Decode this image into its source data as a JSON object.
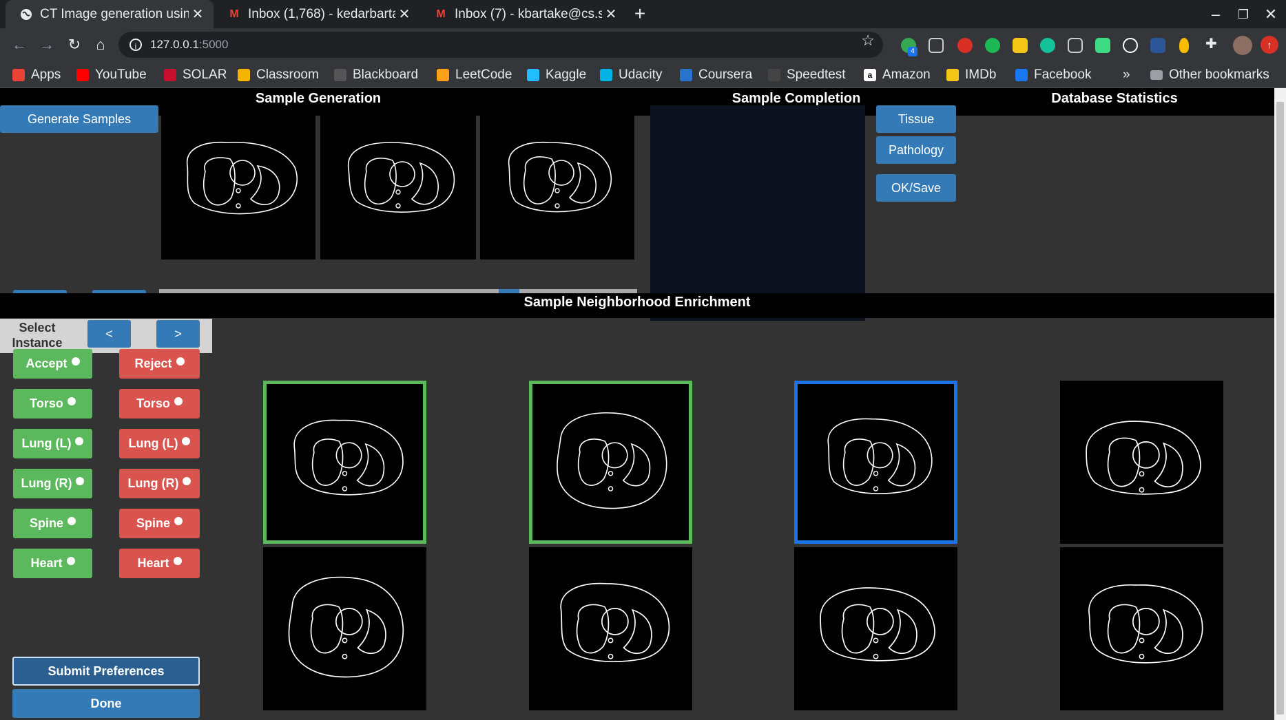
{
  "browser": {
    "tabs": [
      {
        "title": "CT Image generation usin",
        "icon": "globe-icon",
        "active": true
      },
      {
        "title": "Inbox (1,768) - kedarbarta",
        "icon": "gmail-icon",
        "active": false
      },
      {
        "title": "Inbox (7) - kbartake@cs.st",
        "icon": "gmail-icon",
        "active": false
      }
    ],
    "url_host": "127.0.0.1",
    "url_port": ":5000",
    "bookmarks": [
      {
        "label": "Apps",
        "icon": "apps-grid-icon",
        "color": "#ea4335"
      },
      {
        "label": "YouTube",
        "icon": "youtube-icon",
        "color": "#ff0000"
      },
      {
        "label": "SOLAR",
        "icon": "solar-shield-icon",
        "color": "#c8102e"
      },
      {
        "label": "Classroom",
        "icon": "classroom-icon",
        "color": "#f4b400"
      },
      {
        "label": "Blackboard",
        "icon": "blackboard-icon",
        "color": "#555555"
      },
      {
        "label": "LeetCode",
        "icon": "leetcode-icon",
        "color": "#ffa116"
      },
      {
        "label": "Kaggle",
        "icon": "kaggle-icon",
        "color": "#20beff"
      },
      {
        "label": "Udacity",
        "icon": "udacity-icon",
        "color": "#02b3e4"
      },
      {
        "label": "Coursera",
        "icon": "coursera-icon",
        "color": "#2a73cc"
      },
      {
        "label": "Speedtest",
        "icon": "speedtest-icon",
        "color": "#444444"
      },
      {
        "label": "Amazon",
        "icon": "amazon-icon",
        "color": "#ffffff"
      },
      {
        "label": "IMDb",
        "icon": "imdb-icon",
        "color": "#f5c518"
      },
      {
        "label": "Facebook",
        "icon": "facebook-icon",
        "color": "#1877f2"
      }
    ],
    "more_bookmarks": "»",
    "other_bookmarks": "Other bookmarks",
    "extension_badge": "4"
  },
  "app": {
    "sample_generation": {
      "title": "Sample Generation",
      "generate_label": "Generate Samples",
      "prev_label": "<",
      "next_label": ">",
      "slider_fraction": 0.71
    },
    "sample_completion": {
      "title": "Sample Completion",
      "tissue_label": "Tissue",
      "pathology_label": "Pathology",
      "ok_save_label": "OK/Save"
    },
    "database_statistics": {
      "title": "Database Statistics"
    },
    "neighborhood": {
      "title": "Sample Neighborhood Enrichment",
      "select_instance_label": "Select Instance",
      "prev_label": "<",
      "next_label": ">",
      "accept_buttons": [
        "Accept",
        "Torso",
        "Lung (L)",
        "Lung (R)",
        "Spine",
        "Heart"
      ],
      "reject_buttons": [
        "Reject",
        "Torso",
        "Lung (L)",
        "Lung (R)",
        "Spine",
        "Heart"
      ],
      "submit_label": "Submit Preferences",
      "done_label": "Done",
      "grid_states": [
        "accepted",
        "accepted",
        "selected",
        "none",
        "none",
        "none",
        "none",
        "none"
      ]
    },
    "colors": {
      "accept": "#5cb85c",
      "reject": "#d9534f",
      "primary": "#337ab7",
      "selected_border": "#1a73e8",
      "accepted_border": "#5cb85c"
    }
  }
}
